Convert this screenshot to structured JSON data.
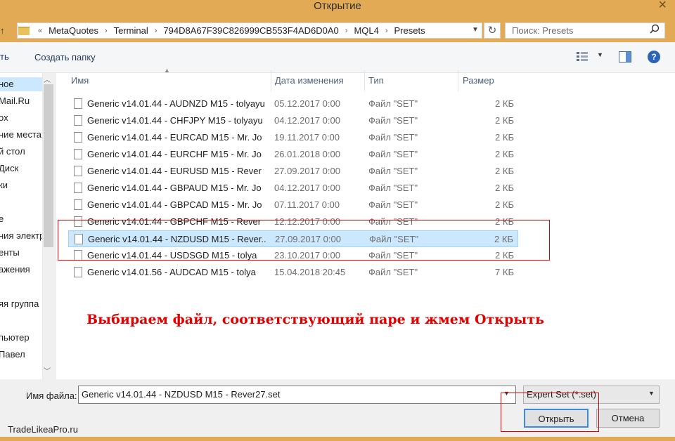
{
  "window": {
    "title": "Открытие",
    "close_glyph": "×"
  },
  "address": {
    "overflow": "«",
    "crumbs": [
      "MetaQuotes",
      "Terminal",
      "794D8A67F39C826999CB553F4AD6D0A0",
      "MQL4",
      "Presets"
    ],
    "separator": "›",
    "search_placeholder": "Поиск: Presets"
  },
  "toolbar": {
    "organize_label": "ть",
    "new_folder_label": "Создать папку",
    "help_label": "?"
  },
  "nav": {
    "items": [
      "ное",
      "Mail.Ru",
      "ox",
      "ние места",
      "й стол",
      "Диск",
      "ки",
      "",
      "е",
      "ния электр",
      "енты",
      "ажения",
      "",
      "яя группа",
      "",
      "пьютер",
      "Павел"
    ]
  },
  "columns": {
    "name": "Имя",
    "date": "Дата изменения",
    "type": "Тип",
    "size": "Размер"
  },
  "files": [
    {
      "name": "Generic v14.01.44 - AUDNZD M15 - tolyayu",
      "date": "05.12.2017 0:00",
      "type": "Файл \"SET\"",
      "size": "2 КБ"
    },
    {
      "name": "Generic v14.01.44 - CHFJPY M15 - tolyayu",
      "date": "04.12.2017 0:00",
      "type": "Файл \"SET\"",
      "size": "2 КБ"
    },
    {
      "name": "Generic v14.01.44 - EURCAD M15 - Mr. Jo",
      "date": "19.11.2017 0:00",
      "type": "Файл \"SET\"",
      "size": "2 КБ"
    },
    {
      "name": "Generic v14.01.44 - EURCHF M15 - Mr. Jo",
      "date": "26.01.2018 0:00",
      "type": "Файл \"SET\"",
      "size": "2 КБ"
    },
    {
      "name": "Generic v14.01.44 - EURUSD M15 - Rever",
      "date": "27.09.2017 0:00",
      "type": "Файл \"SET\"",
      "size": "2 КБ"
    },
    {
      "name": "Generic v14.01.44 - GBPAUD M15 - Mr. Jo",
      "date": "04.12.2017 0:00",
      "type": "Файл \"SET\"",
      "size": "2 КБ"
    },
    {
      "name": "Generic v14.01.44 - GBPCAD M15 - Mr. Jo",
      "date": "07.11.2017 0:00",
      "type": "Файл \"SET\"",
      "size": "2 КБ"
    },
    {
      "name": "Generic v14.01.44 - GBPCHF M15 - Rever",
      "date": "12.12.2017 0:00",
      "type": "Файл \"SET\"",
      "size": "2 КБ"
    },
    {
      "name": "Generic v14.01.44 - NZDUSD M15 - Rever...",
      "date": "27.09.2017 0:00",
      "type": "Файл \"SET\"",
      "size": "2 КБ",
      "selected": true
    },
    {
      "name": "Generic v14.01.44 - USDSGD M15 - tolya",
      "date": "23.10.2017 0:00",
      "type": "Файл \"SET\"",
      "size": "2 КБ"
    },
    {
      "name": "Generic v14.01.56 - AUDCAD M15 - tolya",
      "date": "15.04.2018 20:45",
      "type": "Файл \"SET\"",
      "size": "7 КБ"
    }
  ],
  "annotation": "Выбираем файл, соответствующий паре и жмем Открыть",
  "footer": {
    "filename_label": "Имя файла:",
    "filename_value": "Generic v14.01.44 - NZDUSD M15 - Rever27.set",
    "filetype_value": "Expert Set (*.set)",
    "open_label": "Открыть",
    "cancel_label": "Отмена",
    "watermark": "TradeLikeaPro.ru"
  },
  "colors": {
    "accent": "#e2aa55",
    "selection": "#cce8ff",
    "annotation": "#e00000"
  }
}
